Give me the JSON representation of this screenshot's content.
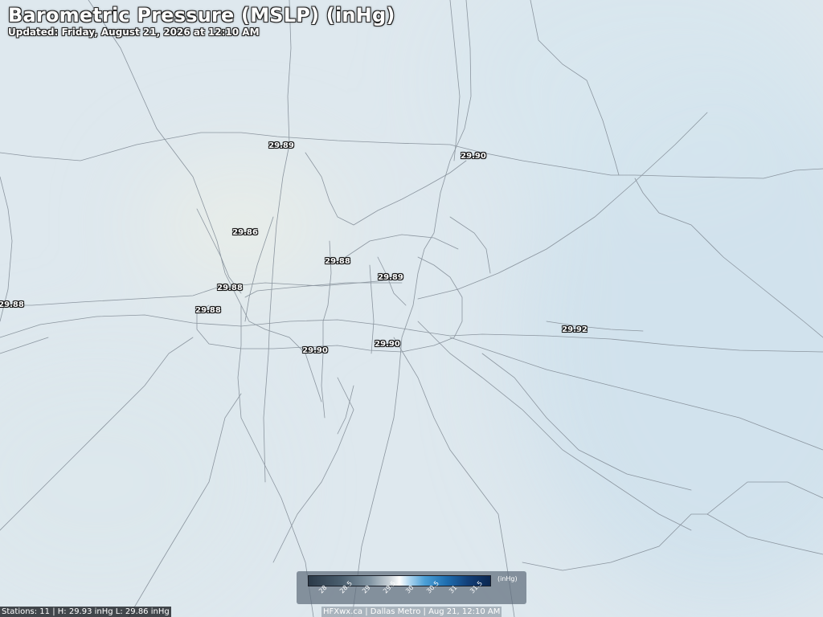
{
  "title": "Barometric Pressure (MSLP) (inHg)",
  "subtitle": "Updated: Friday, August 21, 2026 at 12:10 AM",
  "stations": [
    "29.89",
    "29.90",
    "29.86",
    "29.88",
    "29.89",
    "29.88",
    "29.88",
    "29.88",
    "29.92",
    "29.90",
    "29.90"
  ],
  "legend": {
    "unit": "(inHg)",
    "ticks": [
      "28",
      "28.5",
      "29",
      "29.5",
      "30",
      "30.5",
      "31",
      "31.5"
    ]
  },
  "footer": {
    "stats": "Stations: 11 | H: 29.93 inHg L: 29.86 inHg",
    "credit": "HFXwx.ca | Dallas Metro | Aug 21, 12:10 AM"
  }
}
